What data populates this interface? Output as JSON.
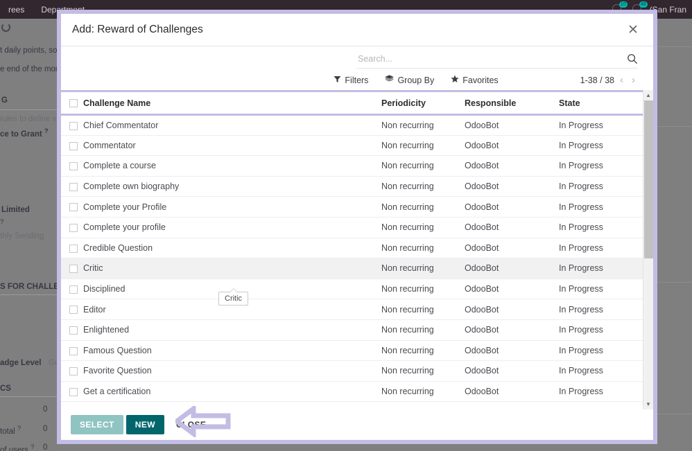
{
  "background": {
    "navbar": {
      "items": [
        "rees",
        "Department"
      ],
      "icons": [
        {
          "name": "messages-icon",
          "badge": "10"
        },
        {
          "name": "activities-icon",
          "badge": "46"
        }
      ],
      "user": "(San Fran"
    },
    "form_fragments": [
      {
        "text": "G",
        "bold": true
      },
      {
        "text": "rules to define v",
        "bold": false
      },
      {
        "text": "ce to Grant",
        "bold": true
      },
      {
        "text": "Limited",
        "bold": true
      },
      {
        "text": "thly Sending",
        "bold": false
      },
      {
        "text": "S FOR CHALLENG",
        "bold": true
      },
      {
        "text": "adge Level",
        "bold": true
      },
      {
        "text": "Go",
        "bold": false
      },
      {
        "text": "CS",
        "bold": true
      },
      {
        "text": "0",
        "bold": false
      },
      {
        "text": "total",
        "bold": false
      },
      {
        "text": "0",
        "bold": false
      },
      {
        "text": "of users",
        "bold": false
      },
      {
        "text": "0",
        "bold": false
      },
      {
        "text": "t daily points, so",
        "bold": false
      },
      {
        "text": "e end of the mon",
        "bold": false
      }
    ]
  },
  "modal": {
    "title": "Add: Reward of Challenges",
    "close_label": "✕",
    "search": {
      "value": "",
      "placeholder": "Search..."
    },
    "controls": {
      "filters_label": "Filters",
      "group_by_label": "Group By",
      "favorites_label": "Favorites",
      "pager_count": "1-38 / 38",
      "prev_label": "‹",
      "next_label": "›"
    },
    "table": {
      "columns": [
        "Challenge Name",
        "Periodicity",
        "Responsible",
        "State"
      ],
      "rows": [
        {
          "name": "Chief Commentator",
          "periodicity": "Non recurring",
          "responsible": "OdooBot",
          "state": "In Progress"
        },
        {
          "name": "Commentator",
          "periodicity": "Non recurring",
          "responsible": "OdooBot",
          "state": "In Progress"
        },
        {
          "name": "Complete a course",
          "periodicity": "Non recurring",
          "responsible": "OdooBot",
          "state": "In Progress"
        },
        {
          "name": "Complete own biography",
          "periodicity": "Non recurring",
          "responsible": "OdooBot",
          "state": "In Progress"
        },
        {
          "name": "Complete your Profile",
          "periodicity": "Non recurring",
          "responsible": "OdooBot",
          "state": "In Progress"
        },
        {
          "name": "Complete your profile",
          "periodicity": "Non recurring",
          "responsible": "OdooBot",
          "state": "In Progress"
        },
        {
          "name": "Credible Question",
          "periodicity": "Non recurring",
          "responsible": "OdooBot",
          "state": "In Progress"
        },
        {
          "name": "Critic",
          "periodicity": "Non recurring",
          "responsible": "OdooBot",
          "state": "In Progress"
        },
        {
          "name": "Disciplined",
          "periodicity": "Non recurring",
          "responsible": "OdooBot",
          "state": "In Progress"
        },
        {
          "name": "Editor",
          "periodicity": "Non recurring",
          "responsible": "OdooBot",
          "state": "In Progress"
        },
        {
          "name": "Enlightened",
          "periodicity": "Non recurring",
          "responsible": "OdooBot",
          "state": "In Progress"
        },
        {
          "name": "Famous Question",
          "periodicity": "Non recurring",
          "responsible": "OdooBot",
          "state": "In Progress"
        },
        {
          "name": "Favorite Question",
          "periodicity": "Non recurring",
          "responsible": "OdooBot",
          "state": "In Progress"
        },
        {
          "name": "Get a certification",
          "periodicity": "Non recurring",
          "responsible": "OdooBot",
          "state": "In Progress"
        }
      ],
      "hovered_row_index": 7
    },
    "tooltip": {
      "text": "Critic"
    },
    "footer": {
      "select_label": "SELECT",
      "new_label": "NEW",
      "close_label": "CLOSE"
    }
  },
  "colors": {
    "modal_border": "#c3bce4",
    "select_button": "#8fc4c2",
    "new_button": "#01666c",
    "annotation_arrow": "#c3bce4",
    "navbar": "#32262f"
  }
}
